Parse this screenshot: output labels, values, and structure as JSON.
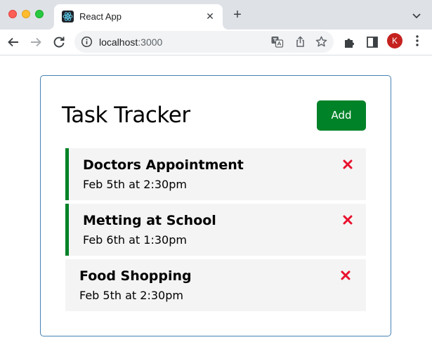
{
  "browser": {
    "tab_title": "React App",
    "tab_close": "✕",
    "new_tab": "+",
    "url_host": "localhost",
    "url_port": ":3000",
    "profile_initial": "K",
    "profile_color": "#c5221f"
  },
  "app": {
    "title": "Task Tracker",
    "add_button_label": "Add",
    "accent_color": "#008228",
    "delete_icon_color": "#e8112d"
  },
  "tasks": [
    {
      "text": "Doctors Appointment",
      "day": "Feb 5th at 2:30pm",
      "reminder": true
    },
    {
      "text": "Metting at School",
      "day": "Feb 6th at 1:30pm",
      "reminder": true
    },
    {
      "text": "Food Shopping",
      "day": "Feb 5th at 2:30pm",
      "reminder": false
    }
  ]
}
